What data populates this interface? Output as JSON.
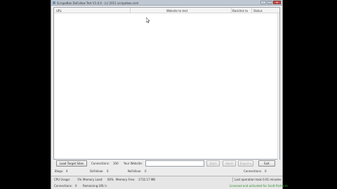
{
  "window": {
    "title": "ScrapeBox DoFollow Test V1.0.0 - (c) 2011 scrapebox.com",
    "minimize": "–",
    "maximize": "□",
    "close": "✕"
  },
  "grid": {
    "columns": [
      "URL",
      "Website to test",
      "Backlink to",
      "Status"
    ]
  },
  "toolbar": {
    "load_button": "Load Target Sites",
    "connections_label": "Connections:",
    "connections_value": "100",
    "website_label": "Your Website:",
    "website_value": "",
    "start_button": "Start",
    "abort_button": "Abort",
    "export_button": "Export ▾",
    "exit_button": "Exit"
  },
  "stats": {
    "blogs_label": "Blogs:",
    "blogs_value": "0",
    "dofollow_label": "DoFollow:",
    "dofollow_value": "0",
    "nofollow_label": "NoFollow:",
    "nofollow_value": "0",
    "connections_label": "Connections:",
    "connections_value": "0"
  },
  "statusbar": {
    "cpu_label": "CPU Usage:",
    "cpu_value": "1%",
    "memory_label": "Memory Load:",
    "memory_value": "60%",
    "memory_free_label": "Memory Free:",
    "memory_free_value": "1732.17 MB",
    "last_update": "Last operation took 0.01 minutes",
    "conn_label": "Connections:",
    "conn_value": "0",
    "remaining_label": "Remaining URL's:",
    "remaining_value": "",
    "license": "Licensed and activated for Scott Richards"
  },
  "colors": {
    "titlebar": "#bfc8d2",
    "close_button": "#c9534b",
    "license_text": "#2e8b2e"
  }
}
